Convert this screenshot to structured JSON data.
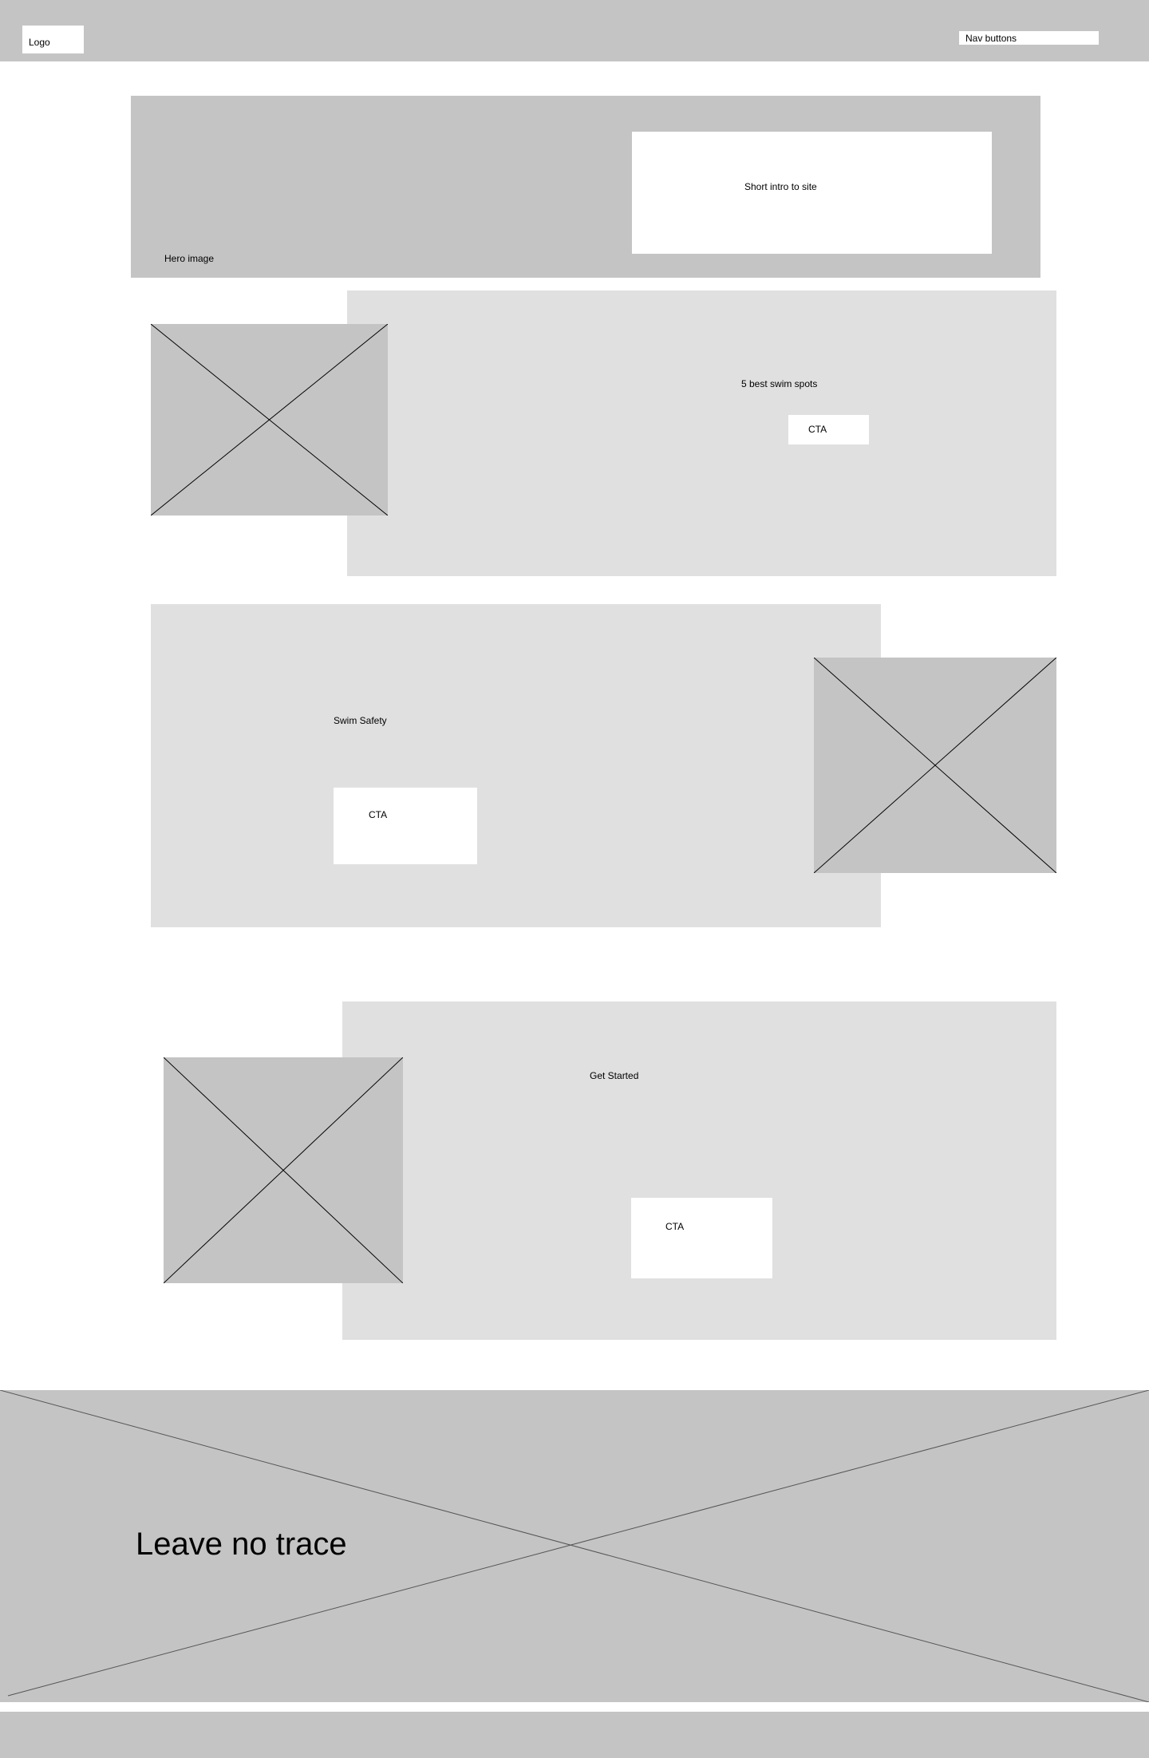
{
  "header": {
    "logo_label": "Logo",
    "nav_label": "Nav buttons"
  },
  "hero": {
    "intro_label": "Short intro to site",
    "image_label": "Hero image"
  },
  "section_spots": {
    "title": "5 best swim spots",
    "cta_label": "CTA"
  },
  "section_safety": {
    "title": "Swim Safety",
    "cta_label": "CTA"
  },
  "section_started": {
    "title": "Get Started",
    "cta_label": "CTA"
  },
  "banner": {
    "title": "Leave no trace"
  },
  "colors": {
    "placeholder_dark": "#c4c4c4",
    "placeholder_light": "#e0e0e0",
    "background": "#ffffff",
    "line": "#000000"
  }
}
